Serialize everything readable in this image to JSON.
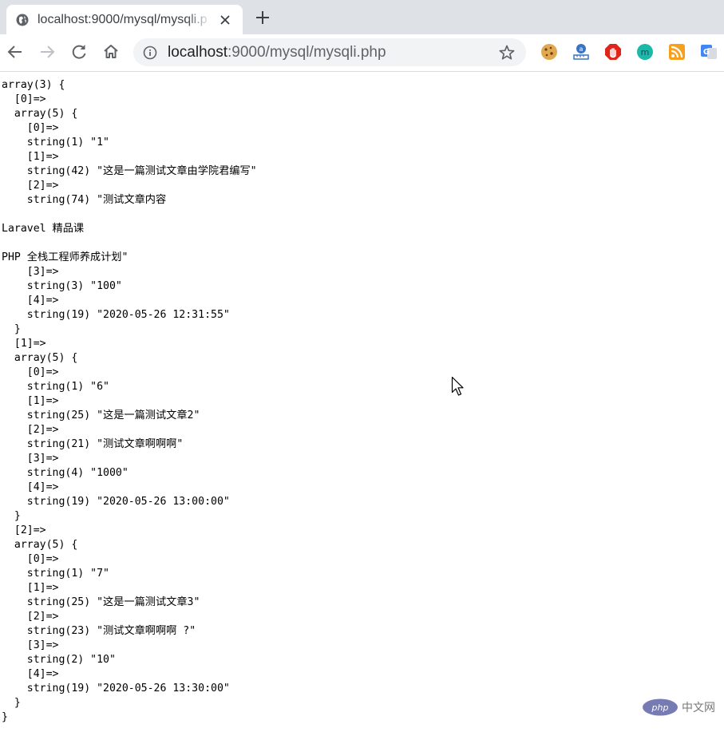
{
  "browser": {
    "tab_title": "localhost:9000/mysql/mysqli.php",
    "url_host": "localhost",
    "url_rest": ":9000/mysql/mysqli.php",
    "extensions": [
      "cookie-icon",
      "ruler-icon",
      "adblock-icon",
      "mercury-icon",
      "rss-icon",
      "translate-icon"
    ]
  },
  "page": {
    "dump_text": "array(3) {\n  [0]=>\n  array(5) {\n    [0]=>\n    string(1) \"1\"\n    [1]=>\n    string(42) \"这是一篇测试文章由学院君编写\"\n    [2]=>\n    string(74) \"测试文章内容\n\nLaravel 精品课\n\nPHP 全栈工程师养成计划\"\n    [3]=>\n    string(3) \"100\"\n    [4]=>\n    string(19) \"2020-05-26 12:31:55\"\n  }\n  [1]=>\n  array(5) {\n    [0]=>\n    string(1) \"6\"\n    [1]=>\n    string(25) \"这是一篇测试文章2\"\n    [2]=>\n    string(21) \"测试文章啊啊啊\"\n    [3]=>\n    string(4) \"1000\"\n    [4]=>\n    string(19) \"2020-05-26 13:00:00\"\n  }\n  [2]=>\n  array(5) {\n    [0]=>\n    string(1) \"7\"\n    [1]=>\n    string(25) \"这是一篇测试文章3\"\n    [2]=>\n    string(23) \"测试文章啊啊啊 ?\"\n    [3]=>\n    string(2) \"10\"\n    [4]=>\n    string(19) \"2020-05-26 13:30:00\"\n  }\n}"
  },
  "watermark": {
    "logo_text": "php",
    "text": "中文网"
  }
}
